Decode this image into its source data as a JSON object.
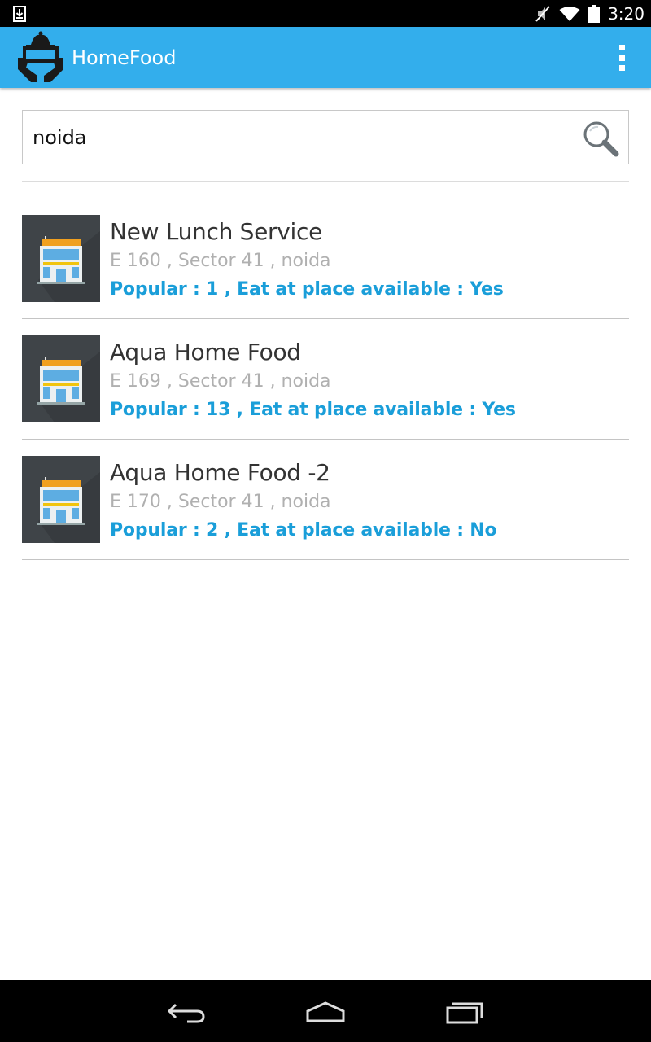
{
  "status_bar": {
    "time": "3:20"
  },
  "app_bar": {
    "title": "HomeFood"
  },
  "search": {
    "value": "noida"
  },
  "listings": [
    {
      "name": "New Lunch Service",
      "address": "E 160 , Sector 41 , noida",
      "meta": "Popular : 1 , Eat at place available : Yes"
    },
    {
      "name": "Aqua Home Food",
      "address": "E 169 , Sector 41 , noida",
      "meta": "Popular : 13 , Eat at place available : Yes"
    },
    {
      "name": "Aqua Home Food -2",
      "address": "E 170 , Sector 41 , noida",
      "meta": "Popular : 2 , Eat at place available : No"
    }
  ],
  "colors": {
    "app_bar": "#33aeec",
    "meta_text": "#1a9ed9",
    "address_text": "#b0b0b0"
  },
  "icons": [
    "download-icon",
    "mute-icon",
    "wifi-icon",
    "battery-icon",
    "app-logo-icon",
    "overflow-menu-icon",
    "search-icon",
    "hotel-thumbnail",
    "back-icon",
    "home-icon",
    "recents-icon"
  ]
}
